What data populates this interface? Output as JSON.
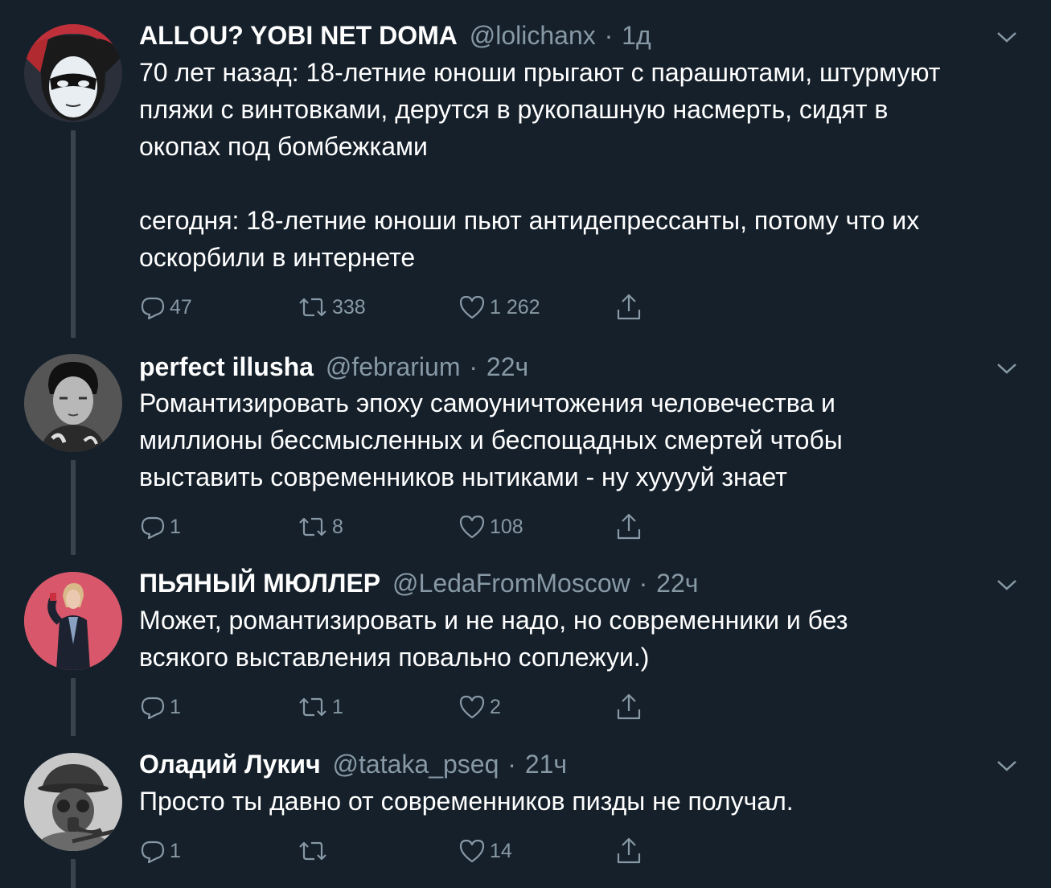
{
  "tweets": [
    {
      "name": "ALLOU? YOBI NET DOMA",
      "handle": "@lolichanx",
      "dot": "·",
      "time": "1д",
      "text": "70 лет назад: 18-летние юноши прыгают с парашютами, штурмуют\nпляжи с винтовками, дерутся в рукопашную насмерть, сидят в\nокопах под бомбежками\n\nсегодня: 18-летние юноши пьют антидепрессанты, потому что их\nоскорбили в интернете",
      "replies": "47",
      "retweets": "338",
      "likes": "1 262"
    },
    {
      "name": "perfect illusha",
      "handle": "@febrarium",
      "dot": "·",
      "time": "22ч",
      "text": "Романтизировать эпоху самоуничтожения человечества и\nмиллионы бессмысленных и беспощадных смертей чтобы\nвыставить современников нытиками - ну хууууй знает",
      "replies": "1",
      "retweets": "8",
      "likes": "108"
    },
    {
      "name": "ПЬЯНЫЙ МЮЛЛЕР",
      "handle": "@LedaFromMoscow",
      "dot": "·",
      "time": "22ч",
      "text": "Может, романтизировать и не надо, но современники и без\nвсякого выставления повально соплежуи.)",
      "replies": "1",
      "retweets": "1",
      "likes": "2"
    },
    {
      "name": "Оладий Лукич",
      "handle": "@tataka_pseq",
      "dot": "·",
      "time": "21ч",
      "text": "Просто ты давно от современников пизды не получал.",
      "replies": "1",
      "retweets": "",
      "likes": "14"
    }
  ],
  "icons": {
    "reply": "reply-icon",
    "retweet": "retweet-icon",
    "like": "heart-icon",
    "share": "share-icon",
    "more": "chevron-down-icon"
  },
  "colors": {
    "background": "#15202b",
    "text": "#ffffff",
    "secondary": "#8899a6",
    "thread_line": "#38444d"
  }
}
